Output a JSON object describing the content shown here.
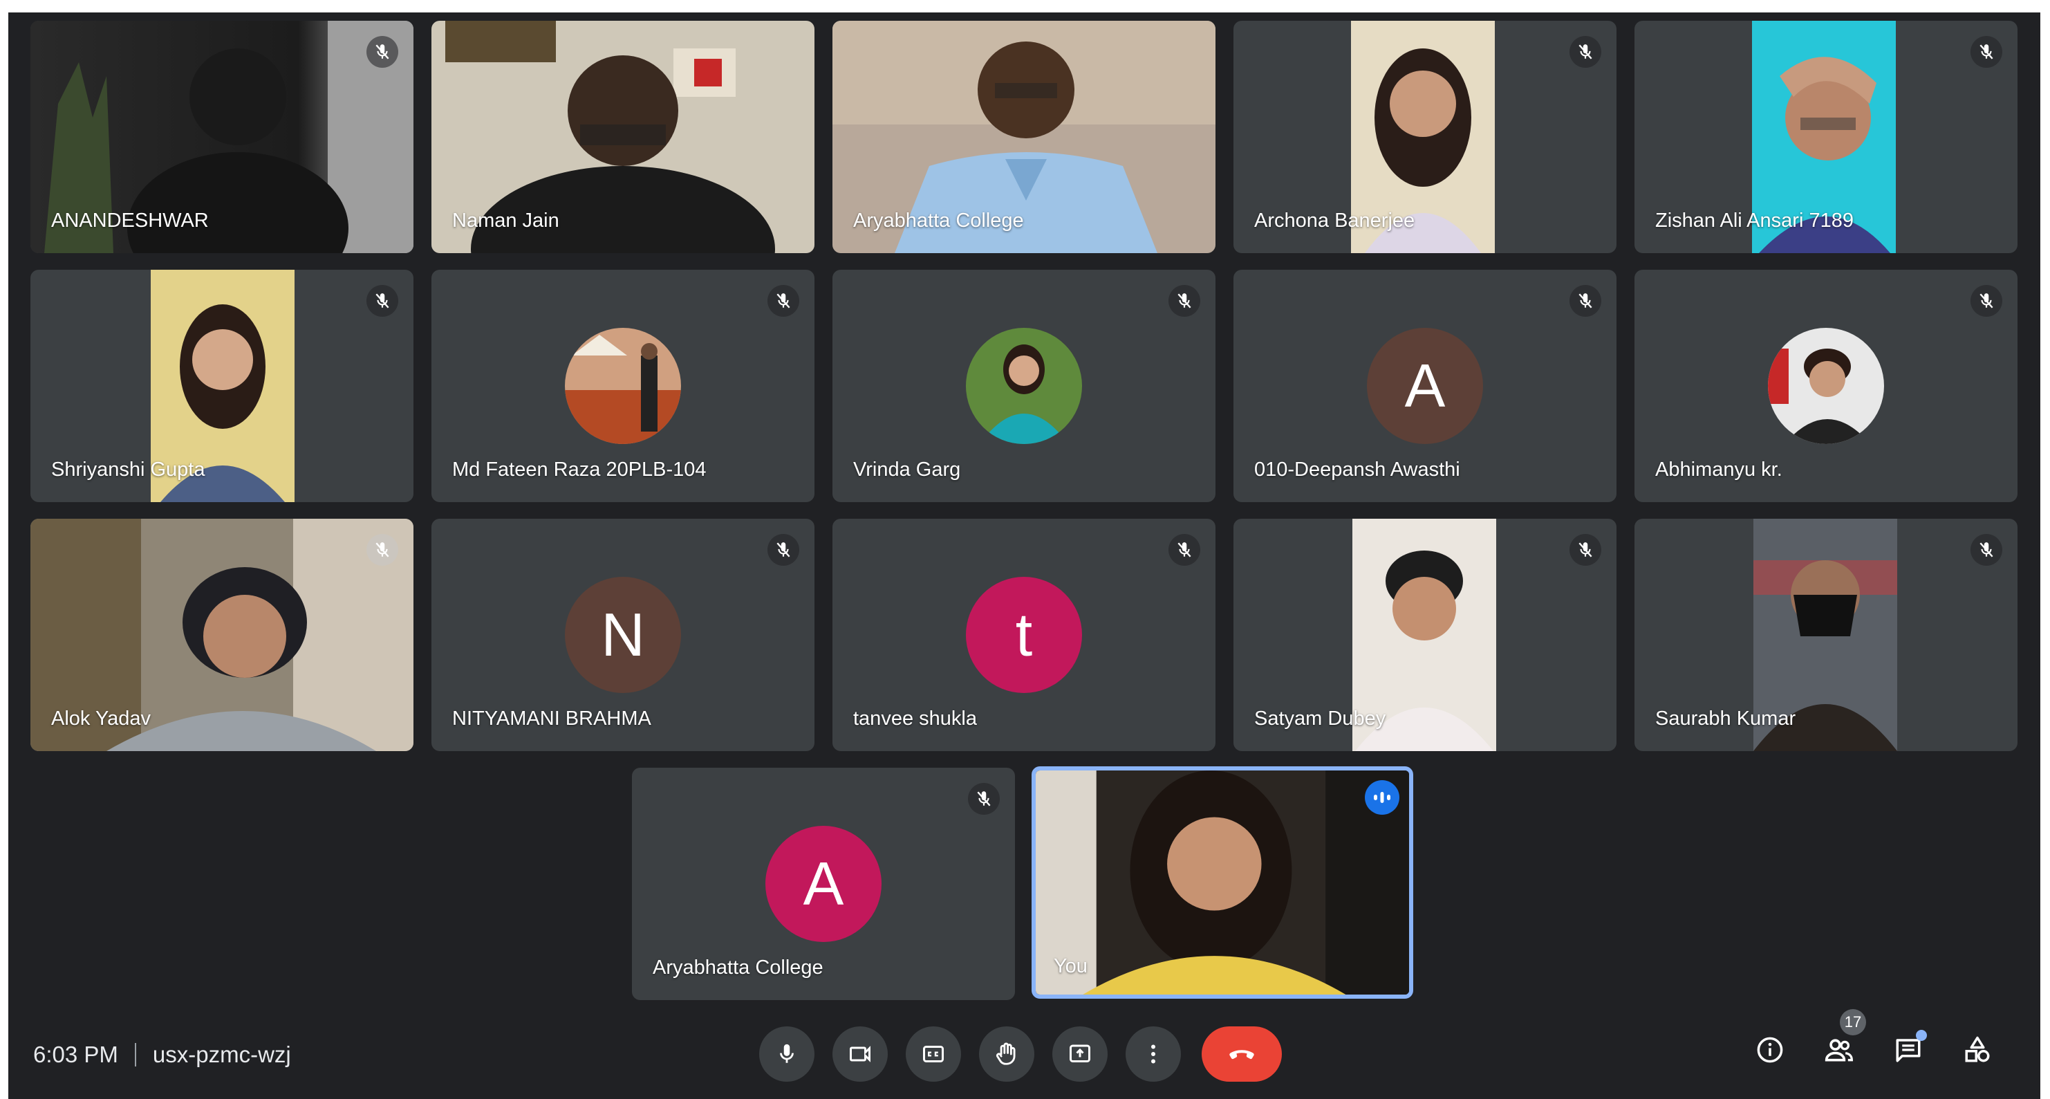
{
  "meeting": {
    "time": "6:03 PM",
    "code": "usx-pzmc-wzj"
  },
  "participants": [
    {
      "name": "ANANDESHWAR",
      "muted": true,
      "kind": "video"
    },
    {
      "name": "Naman Jain",
      "kind": "video"
    },
    {
      "name": "Aryabhatta College",
      "kind": "video"
    },
    {
      "name": "Archona Banerjee",
      "muted": true,
      "kind": "video"
    },
    {
      "name": "Zishan Ali Ansari 7189",
      "muted": true,
      "kind": "video"
    },
    {
      "name": "Shriyanshi Gupta",
      "muted": true,
      "kind": "video"
    },
    {
      "name": "Md Fateen Raza 20PLB-104",
      "muted": true,
      "kind": "photo-avatar"
    },
    {
      "name": "Vrinda Garg",
      "muted": true,
      "kind": "photo-avatar"
    },
    {
      "name": "010-Deepansh Awasthi",
      "muted": true,
      "kind": "letter-avatar",
      "initial": "A",
      "avatar_color": "#5d4037"
    },
    {
      "name": "Abhimanyu kr.",
      "muted": true,
      "kind": "photo-avatar"
    },
    {
      "name": "Alok Yadav",
      "muted": true,
      "kind": "video"
    },
    {
      "name": "NITYAMANI BRAHMA",
      "muted": true,
      "kind": "letter-avatar",
      "initial": "N",
      "avatar_color": "#5d4037"
    },
    {
      "name": "tanvee shukla",
      "muted": true,
      "kind": "letter-avatar",
      "initial": "t",
      "avatar_color": "#c2185b"
    },
    {
      "name": "Satyam Dubey",
      "muted": true,
      "kind": "video"
    },
    {
      "name": "Saurabh Kumar",
      "muted": true,
      "kind": "video"
    },
    {
      "name": "Aryabhatta College",
      "muted": true,
      "kind": "letter-avatar",
      "initial": "A",
      "avatar_color": "#c2185b"
    },
    {
      "name": "You",
      "speaking": true,
      "kind": "video"
    }
  ],
  "toolbar": {
    "buttons": [
      "mic-icon",
      "camera-icon",
      "captions-icon",
      "raise-hand-icon",
      "present-icon",
      "more-options-icon",
      "end-call-icon"
    ],
    "end_call_color": "#ea4335"
  },
  "side_panel": {
    "people_count": "17",
    "icons": [
      "info-icon",
      "people-icon",
      "chat-icon",
      "activities-icon"
    ]
  },
  "colors": {
    "background": "#202124",
    "tile": "#3c4043",
    "active_border": "#8ab4f8",
    "speaking_badge": "#1a73e8"
  }
}
